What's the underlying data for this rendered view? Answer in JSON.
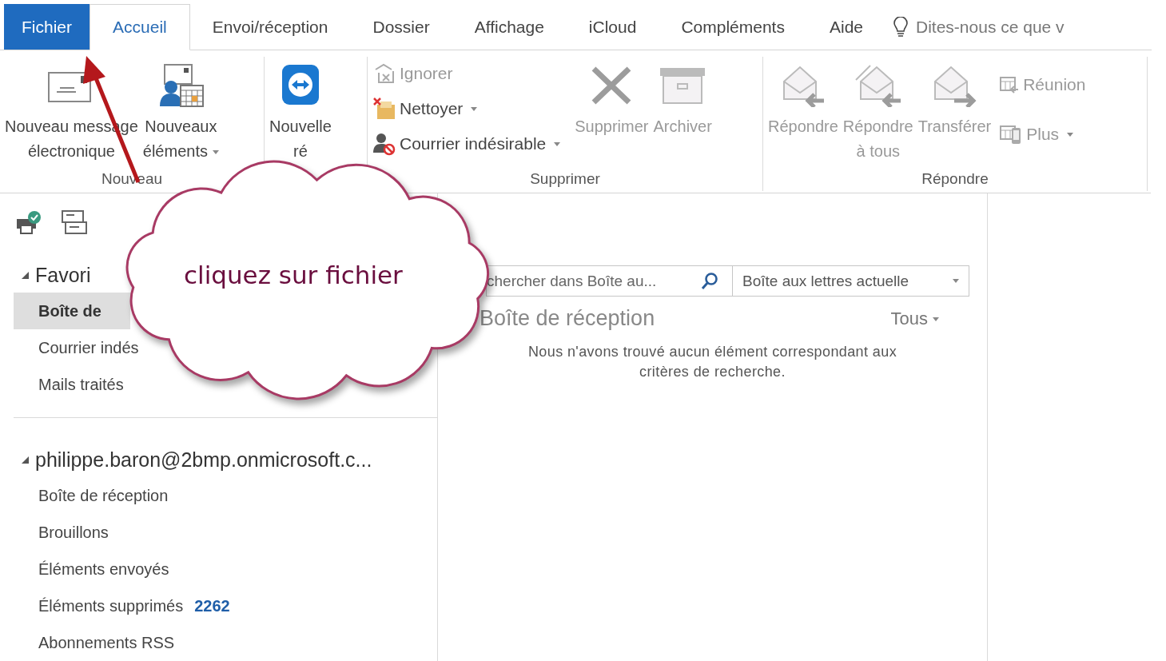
{
  "menu_tabs": [
    {
      "label": "Fichier",
      "kind": "file",
      "selected": false
    },
    {
      "label": "Accueil",
      "kind": "tab",
      "selected": true
    },
    {
      "label": "Envoi/réception",
      "kind": "tab",
      "selected": false
    },
    {
      "label": "Dossier",
      "kind": "tab",
      "selected": false
    },
    {
      "label": "Affichage",
      "kind": "tab",
      "selected": false
    },
    {
      "label": "iCloud",
      "kind": "tab",
      "selected": false
    },
    {
      "label": "Compléments",
      "kind": "tab",
      "selected": false
    },
    {
      "label": "Aide",
      "kind": "tab",
      "selected": false
    }
  ],
  "tell_me": {
    "placeholder": "Dites-nous ce que v"
  },
  "ribbon_groups": [
    {
      "label": "Nouveau",
      "buttons": [
        {
          "kind": "large",
          "label": "Nouveau message\nélectronique",
          "disabled": false,
          "dropdown": false
        },
        {
          "kind": "large",
          "label": "Nouveaux\néléments",
          "disabled": false,
          "dropdown": true
        }
      ]
    },
    {
      "buttons": [
        {
          "kind": "large",
          "label": "Nouvelle\nré",
          "disabled": false,
          "dropdown": false
        }
      ]
    },
    {
      "label": "Supprimer",
      "buttons": [
        {
          "kind": "small",
          "label": "Ignorer",
          "disabled": true,
          "dropdown": false
        },
        {
          "kind": "small",
          "label": "Nettoyer",
          "disabled": false,
          "dropdown": true
        },
        {
          "kind": "small",
          "label": "Courrier indésirable",
          "disabled": false,
          "dropdown": true
        },
        {
          "kind": "large",
          "label": "Supprimer",
          "disabled": true,
          "dropdown": false
        },
        {
          "kind": "large",
          "label": "Archiver",
          "disabled": true,
          "dropdown": false
        }
      ]
    },
    {
      "label": "Répondre",
      "buttons": [
        {
          "kind": "large",
          "label": "Répondre",
          "disabled": true,
          "dropdown": false
        },
        {
          "kind": "large",
          "label": "Répondre\nà tous",
          "disabled": true,
          "dropdown": false
        },
        {
          "kind": "large",
          "label": "Transférer",
          "disabled": true,
          "dropdown": false
        },
        {
          "kind": "small",
          "label": "Réunion",
          "disabled": true,
          "dropdown": false
        },
        {
          "kind": "small",
          "label": "Plus",
          "disabled": true,
          "dropdown": true
        }
      ]
    }
  ],
  "folder_sections": [
    {
      "title": "Favori",
      "expanded": true,
      "items": [
        {
          "label": "Boîte de",
          "selected": true
        },
        {
          "label": "Courrier indés",
          "selected": false
        },
        {
          "label": "Mails traités",
          "selected": false
        }
      ]
    },
    {
      "title": "philippe.baron@2bmp.onmicrosoft.c...",
      "expanded": true,
      "items": [
        {
          "label": "Boîte de réception",
          "selected": false
        },
        {
          "label": "Brouillons",
          "selected": false
        },
        {
          "label": "Éléments envoyés",
          "selected": false
        },
        {
          "label": "Éléments supprimés",
          "count": "2262",
          "selected": false
        },
        {
          "label": "Abonnements RSS",
          "selected": false
        }
      ]
    }
  ],
  "message_list": {
    "search": {
      "placeholder": "chercher dans Boîte au..."
    },
    "scope": "Boîte aux lettres actuelle",
    "title": "Boîte de réception",
    "filter": "Tous",
    "empty_message": "Nous n'avons trouvé aucun élément correspondant aux\ncritères de recherche."
  },
  "annotation": {
    "text": "cliquez sur fichier"
  }
}
